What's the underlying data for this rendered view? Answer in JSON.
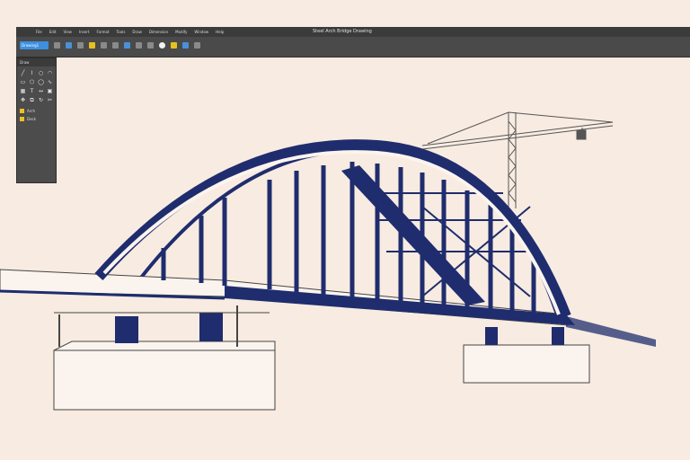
{
  "app": {
    "window_title": "Steel Arch Bridge Drawing"
  },
  "menu_items": [
    "File",
    "Edit",
    "View",
    "Insert",
    "Format",
    "Tools",
    "Draw",
    "Dimension",
    "Modify",
    "Window",
    "Help"
  ],
  "toolbar": {
    "name_box_value": "Drawing1",
    "icons": [
      "new-icon",
      "open-icon",
      "save-icon",
      "print-icon",
      "undo-icon",
      "redo-icon",
      "pan-icon",
      "zoom-icon",
      "layer-icon",
      "properties-icon",
      "match-icon",
      "measure-icon",
      "search-icon"
    ]
  },
  "tool_panel": {
    "title": "Draw",
    "tools": [
      "line",
      "polyline",
      "circle",
      "arc",
      "rectangle",
      "polygon",
      "ellipse",
      "spline",
      "hatch",
      "text",
      "dimension",
      "block",
      "move",
      "copy",
      "rotate",
      "trim"
    ],
    "layers": [
      {
        "name": "Arch",
        "color": "#f0c020"
      },
      {
        "name": "Deck",
        "color": "#f0c020"
      }
    ]
  },
  "colors": {
    "background": "#f8ebe1",
    "structure": "#1f2d6e",
    "line_art": "#444444",
    "crane": "#555555",
    "ui_dark": "#3b3b3b",
    "accent_blue": "#3d8fe0",
    "accent_yellow": "#e8c020"
  }
}
